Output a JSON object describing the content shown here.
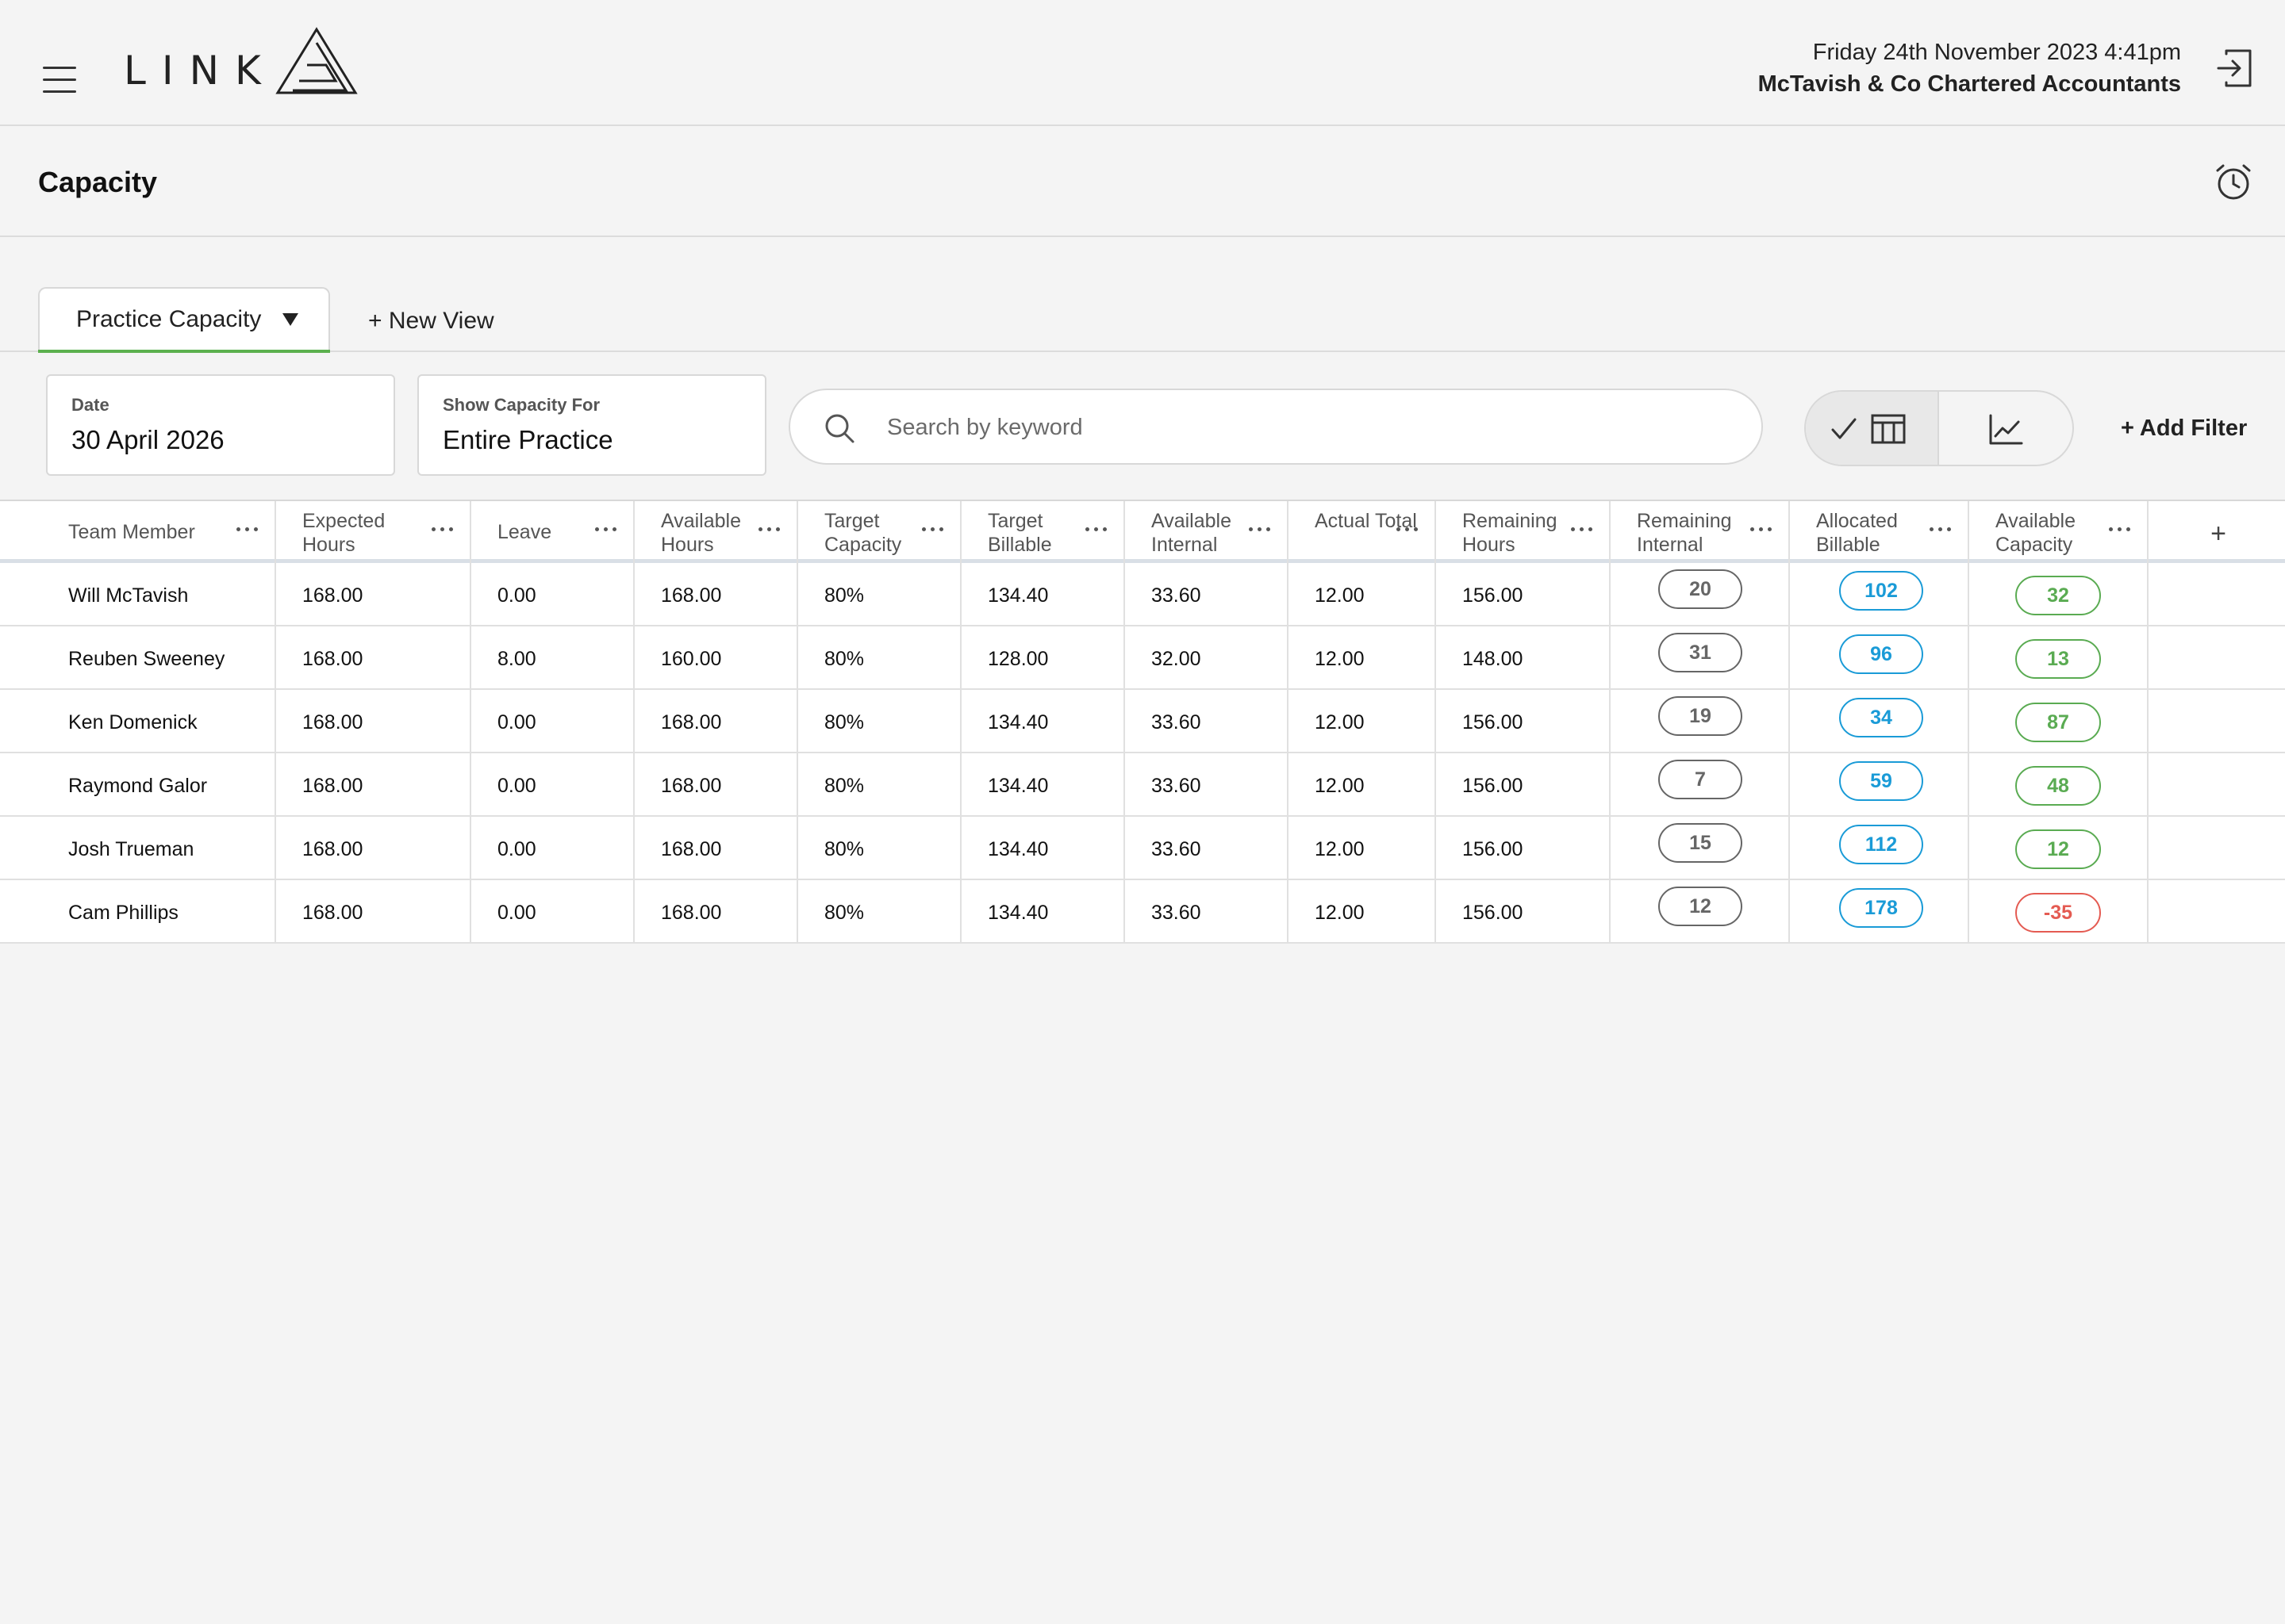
{
  "header": {
    "app_name": "LINK",
    "date_time": "Friday 24th November 2023  4:41pm",
    "company": "McTavish & Co Chartered Accountants"
  },
  "page": {
    "title": "Capacity"
  },
  "tabs": {
    "active_label": "Practice Capacity",
    "new_view_label": "+ New View"
  },
  "filters": {
    "date": {
      "label": "Date",
      "value": "30 April 2026"
    },
    "show_for": {
      "label": "Show Capacity For",
      "value": "Entire Practice"
    },
    "search_placeholder": "Search by keyword",
    "add_filter_label": "+ Add Filter"
  },
  "table": {
    "columns": [
      "Team Member",
      "Expected Hours",
      "Leave",
      "Available Hours",
      "Target Capacity",
      "Target Billable",
      "Available Internal",
      "Actual Total",
      "Remaining Hours",
      "Remaining Internal",
      "Allocated Billable",
      "Available Capacity"
    ],
    "add_column_label": "+",
    "rows": [
      {
        "name": "Will McTavish",
        "expected": "168.00",
        "leave": "0.00",
        "available": "168.00",
        "target_capacity": "80%",
        "target_billable": "134.40",
        "available_internal": "33.60",
        "actual_total": "12.00",
        "remaining_hours": "156.00",
        "remaining_internal": "20",
        "allocated_billable": "102",
        "available_capacity": "32",
        "capacity_status": "positive"
      },
      {
        "name": "Reuben Sweeney",
        "expected": "168.00",
        "leave": "8.00",
        "available": "160.00",
        "target_capacity": "80%",
        "target_billable": "128.00",
        "available_internal": "32.00",
        "actual_total": "12.00",
        "remaining_hours": "148.00",
        "remaining_internal": "31",
        "allocated_billable": "96",
        "available_capacity": "13",
        "capacity_status": "positive"
      },
      {
        "name": "Ken Domenick",
        "expected": "168.00",
        "leave": "0.00",
        "available": "168.00",
        "target_capacity": "80%",
        "target_billable": "134.40",
        "available_internal": "33.60",
        "actual_total": "12.00",
        "remaining_hours": "156.00",
        "remaining_internal": "19",
        "allocated_billable": "34",
        "available_capacity": "87",
        "capacity_status": "positive"
      },
      {
        "name": "Raymond Galor",
        "expected": "168.00",
        "leave": "0.00",
        "available": "168.00",
        "target_capacity": "80%",
        "target_billable": "134.40",
        "available_internal": "33.60",
        "actual_total": "12.00",
        "remaining_hours": "156.00",
        "remaining_internal": "7",
        "allocated_billable": "59",
        "available_capacity": "48",
        "capacity_status": "positive"
      },
      {
        "name": "Josh Trueman",
        "expected": "168.00",
        "leave": "0.00",
        "available": "168.00",
        "target_capacity": "80%",
        "target_billable": "134.40",
        "available_internal": "33.60",
        "actual_total": "12.00",
        "remaining_hours": "156.00",
        "remaining_internal": "15",
        "allocated_billable": "112",
        "available_capacity": "12",
        "capacity_status": "positive"
      },
      {
        "name": "Cam Phillips",
        "expected": "168.00",
        "leave": "0.00",
        "available": "168.00",
        "target_capacity": "80%",
        "target_billable": "134.40",
        "available_internal": "33.60",
        "actual_total": "12.00",
        "remaining_hours": "156.00",
        "remaining_internal": "12",
        "allocated_billable": "178",
        "available_capacity": "-35",
        "capacity_status": "negative"
      }
    ]
  },
  "colors": {
    "accent_green": "#5bb04e",
    "pill_internal": "#666666",
    "pill_billable": "#1a9bd7",
    "pill_capacity_positive": "#5aab52",
    "pill_capacity_negative": "#e45b52"
  },
  "icons": {
    "menu": "hamburger-menu-icon",
    "logo": "link-triangle-logo",
    "logout": "logout-icon",
    "alarm": "alarm-clock-icon",
    "search": "search-icon",
    "table_view": "table-view-icon",
    "chart_view": "line-chart-icon",
    "selected": "checkmark-icon",
    "column_menu": "ellipsis-icon"
  }
}
